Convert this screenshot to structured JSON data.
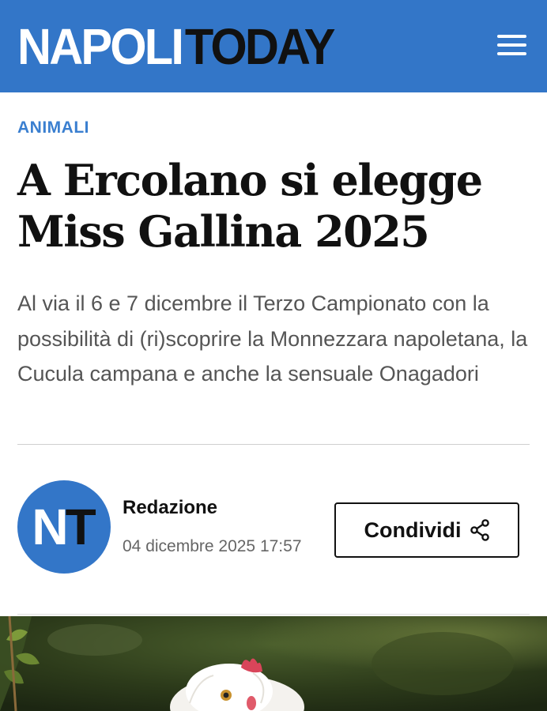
{
  "header": {
    "logo_part1": "NAPOLI",
    "logo_part2": "TODAY",
    "menu_icon": "hamburger-menu-icon",
    "background_color": "#3376c8"
  },
  "article": {
    "category": "ANIMALI",
    "title": "A Ercolano si elegge Miss Gallina 2025",
    "subtitle": "Al via il 6 e 7 dicembre il Terzo Campionato con la possibilità di (ri)scoprire la Monnezzara napoletana, la Cucula campana e anche la sensuale Onagadori",
    "accent_color": "#3a7fd0"
  },
  "author": {
    "avatar_initial_1": "N",
    "avatar_initial_2": "T",
    "name": "Redazione",
    "date": "04 dicembre 2025 17:57"
  },
  "share": {
    "label": "Condividi",
    "icon": "share-icon"
  },
  "hero_image": {
    "subject": "chicken-photo"
  }
}
